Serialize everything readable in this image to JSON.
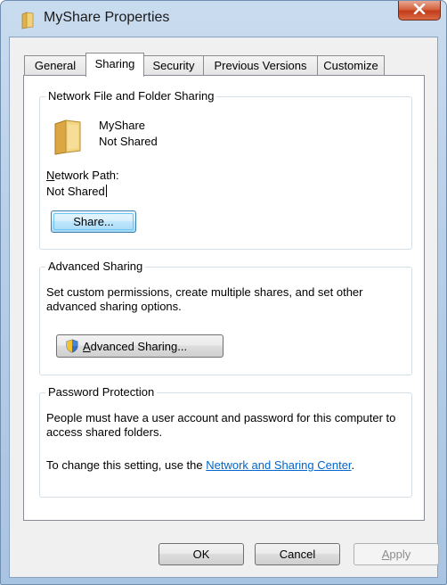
{
  "window": {
    "title": "MyShare Properties",
    "close_label": "X"
  },
  "tabs": [
    {
      "label": "General",
      "active": false
    },
    {
      "label": "Sharing",
      "active": true
    },
    {
      "label": "Security",
      "active": false
    },
    {
      "label": "Previous Versions",
      "active": false
    },
    {
      "label": "Customize",
      "active": false
    }
  ],
  "network_sharing": {
    "group_title": "Network File and Folder Sharing",
    "folder_name": "MyShare",
    "folder_status": "Not Shared",
    "path_label_first": "N",
    "path_label_rest": "etwork Path:",
    "path_value": "Not Shared",
    "share_button": "Share..."
  },
  "advanced_sharing": {
    "group_title": "Advanced Sharing",
    "description": "Set custom permissions, create multiple shares, and set other advanced sharing options.",
    "button_first": "A",
    "button_rest": "dvanced Sharing..."
  },
  "password_protection": {
    "group_title": "Password Protection",
    "description": "People must have a user account and password for this computer to access shared folders.",
    "change_prefix": "To change this setting, use the ",
    "link_text": "Network and Sharing Center",
    "change_suffix": "."
  },
  "footer": {
    "ok": "OK",
    "cancel": "Cancel",
    "apply_first": "A",
    "apply_rest": "pply"
  },
  "colors": {
    "link": "#0066cc",
    "close_button": "#c43c1a",
    "focus_button": "#3c7fb1"
  },
  "icons": {
    "title": "folder-icon",
    "folder": "folder-icon",
    "shield": "uac-shield-icon"
  }
}
